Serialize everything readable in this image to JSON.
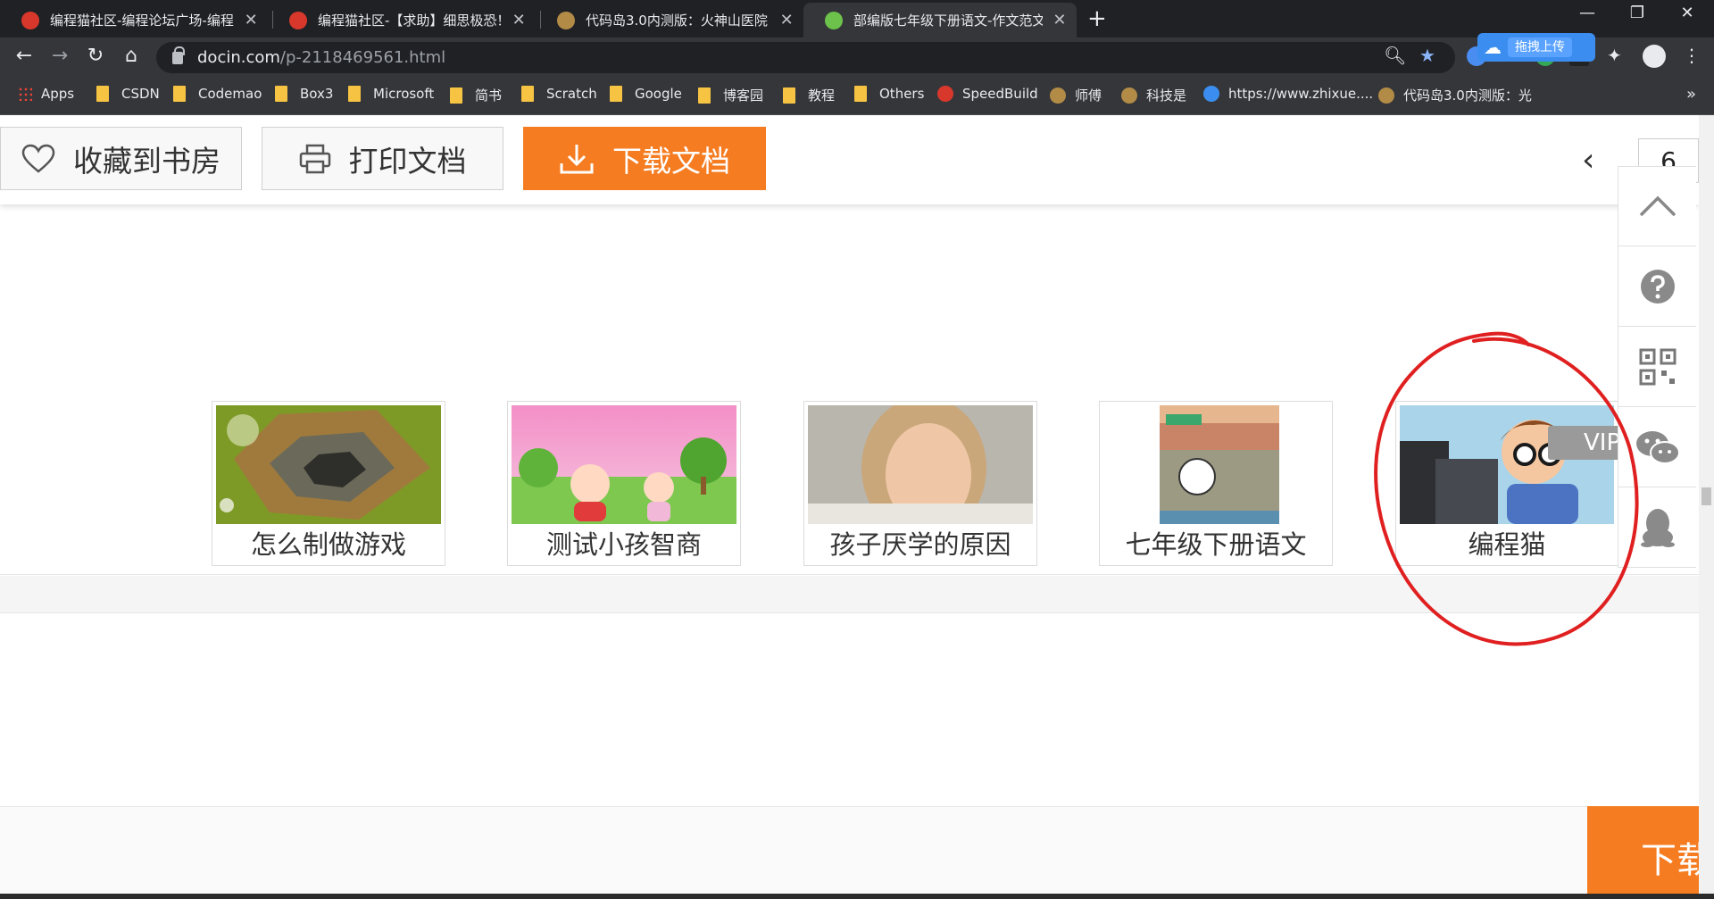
{
  "browser": {
    "tabs": [
      {
        "title": "编程猫社区-编程论坛广场-编程学",
        "close": "✕",
        "active": false
      },
      {
        "title": "编程猫社区-【求助】细思极恐！",
        "close": "✕",
        "active": false
      },
      {
        "title": "代码岛3.0内测版：火神山医院",
        "close": "✕",
        "active": false
      },
      {
        "title": "部编版七年级下册语文-作文范文",
        "close": "✕",
        "active": true
      }
    ],
    "new_tab": "+",
    "window_controls": {
      "minimize": "—",
      "restore": "❐",
      "close": "✕"
    },
    "address": {
      "host": "docin.com",
      "path": "/p-2118469561.html"
    },
    "upload_pill": {
      "label": "拖拽上传"
    },
    "bookmarks": [
      "Apps",
      "CSDN",
      "Codemao",
      "Box3",
      "Microsoft",
      "简书",
      "Scratch",
      "Google",
      "博客园",
      "教程",
      "Others",
      "SpeedBuild",
      "师傅",
      "科技是",
      "https://www.zhixue....",
      "代码岛3.0内测版：光"
    ],
    "bookmarks_more": "»"
  },
  "page": {
    "actions": {
      "favorite": "收藏到书房",
      "print": "打印文档",
      "download": "下载文档"
    },
    "pager": {
      "prev": "‹",
      "current": "6"
    },
    "related": [
      {
        "caption": "怎么制做游戏"
      },
      {
        "caption": "测试小孩智商"
      },
      {
        "caption": "孩子厌学的原因"
      },
      {
        "caption": "七年级下册语文"
      },
      {
        "caption": "编程猫"
      }
    ],
    "vip_tag": "VIP",
    "download_corner": "下载"
  },
  "colors": {
    "accent": "#f57c21",
    "annotation": "#e02020"
  }
}
